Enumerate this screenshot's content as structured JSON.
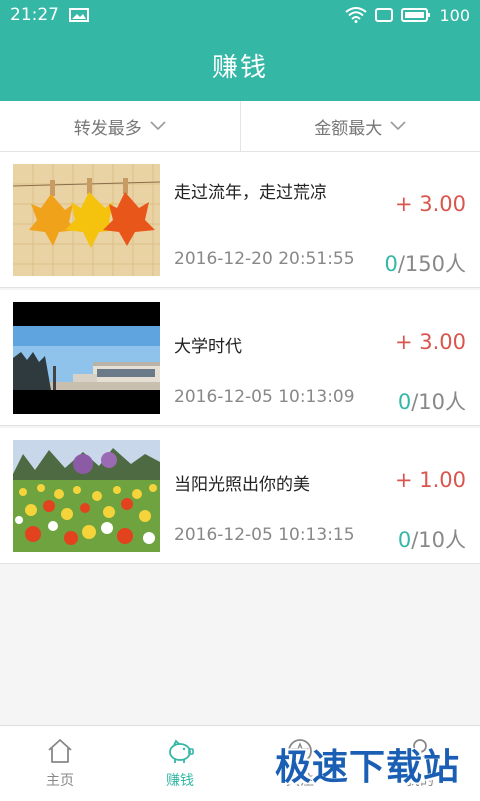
{
  "status": {
    "time": "21:27",
    "battery": "100"
  },
  "header": {
    "title": "赚钱"
  },
  "filters": [
    {
      "label": "转发最多"
    },
    {
      "label": "金额最大"
    }
  ],
  "items": [
    {
      "title": "走过流年，走过荒凉",
      "amount": "+ 3.00",
      "date": "2016-12-20 20:51:55",
      "count_done": "0",
      "count_total": "/150人"
    },
    {
      "title": "大学时代",
      "amount": "+ 3.00",
      "date": "2016-12-05 10:13:09",
      "count_done": "0",
      "count_total": "/10人"
    },
    {
      "title": "当阳光照出你的美",
      "amount": "+ 1.00",
      "date": "2016-12-05 10:13:15",
      "count_done": "0",
      "count_total": "/10人"
    }
  ],
  "tabs": [
    {
      "label": "主页",
      "icon": "home-icon"
    },
    {
      "label": "赚钱",
      "icon": "piggy-bank-icon",
      "active": true
    },
    {
      "label": "关注",
      "icon": "star-icon"
    },
    {
      "label": "我的",
      "icon": "user-icon"
    }
  ],
  "watermark": "极速下载站",
  "colors": {
    "primary": "#35b7a6",
    "amount": "#d9554d"
  }
}
